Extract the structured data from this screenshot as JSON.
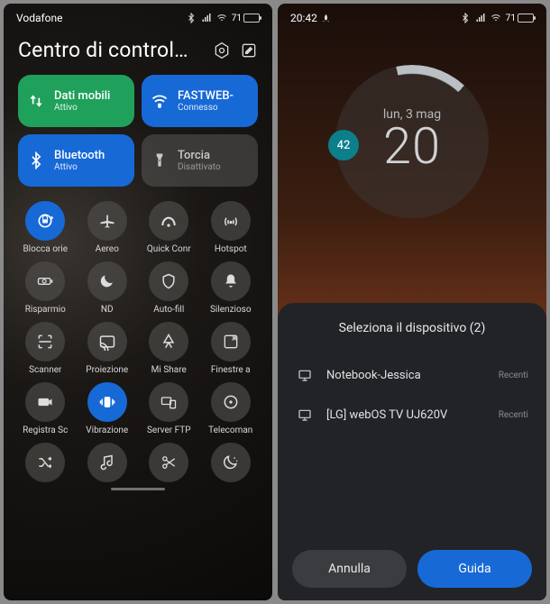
{
  "left": {
    "status": {
      "carrier": "Vodafone",
      "battery": "71"
    },
    "header": {
      "title": "Centro di control…",
      "settings_icon": "gear",
      "edit_icon": "edit"
    },
    "tiles": [
      {
        "name": "mobile-data",
        "label": "Dati mobili",
        "sub": "Attivo",
        "color": "green",
        "icon": "arrows-ud"
      },
      {
        "name": "wifi",
        "label": "FASTWEB-",
        "sub": "Connesso",
        "color": "blue",
        "icon": "wifi"
      },
      {
        "name": "bluetooth",
        "label": "Bluetooth",
        "sub": "Attivo",
        "color": "blue",
        "icon": "bluetooth"
      },
      {
        "name": "torch",
        "label": "Torcia",
        "sub": "Disattivato",
        "color": "grey",
        "icon": "torch"
      }
    ],
    "toggles": [
      {
        "name": "rotation-lock",
        "label": "Blocca orie",
        "icon": "lock-rot",
        "active": true
      },
      {
        "name": "airplane",
        "label": "Aereo",
        "icon": "airplane",
        "active": false
      },
      {
        "name": "quick-connect",
        "label": "Quick Conr",
        "icon": "vpn",
        "active": false
      },
      {
        "name": "hotspot",
        "label": "Hotspot",
        "icon": "hotspot",
        "active": false
      },
      {
        "name": "battery-saver",
        "label": "Risparmio",
        "icon": "battery",
        "active": false
      },
      {
        "name": "dnd",
        "label": "ND",
        "icon": "moon",
        "active": false
      },
      {
        "name": "autofill",
        "label": "Auto-fill",
        "icon": "shield",
        "active": false
      },
      {
        "name": "silent",
        "label": "Silenzioso",
        "icon": "bell",
        "active": false
      },
      {
        "name": "scanner",
        "label": "Scanner",
        "icon": "scan",
        "active": false
      },
      {
        "name": "cast",
        "label": "Proiezione",
        "icon": "cast",
        "active": false
      },
      {
        "name": "mi-share",
        "label": "Mi Share",
        "icon": "share",
        "active": false
      },
      {
        "name": "float-window",
        "label": "Finestre a",
        "icon": "float",
        "active": false
      },
      {
        "name": "screen-record",
        "label": "Registra Sc",
        "icon": "camera",
        "active": false
      },
      {
        "name": "vibration",
        "label": "Vibrazione",
        "icon": "vibrate",
        "active": true
      },
      {
        "name": "ftp",
        "label": "Server FTP",
        "icon": "devices",
        "active": false
      },
      {
        "name": "remote",
        "label": "Telecoman",
        "icon": "remote",
        "active": false
      },
      {
        "name": "shuffle",
        "label": "",
        "icon": "shuffle",
        "active": false
      },
      {
        "name": "music",
        "label": "",
        "icon": "music",
        "active": false
      },
      {
        "name": "screenshot",
        "label": "",
        "icon": "scissors",
        "active": false
      },
      {
        "name": "night",
        "label": "",
        "icon": "night",
        "active": false
      }
    ]
  },
  "right": {
    "status": {
      "time": "20:42",
      "battery": "71"
    },
    "clock": {
      "date_line": "lun, 3 mag",
      "hour": "20",
      "minute": "42"
    },
    "sheet": {
      "title": "Seleziona il dispositivo (2)",
      "devices": [
        {
          "name": "Notebook-Jessica",
          "tag": "Recenti",
          "icon": "monitor"
        },
        {
          "name": "[LG] webOS TV UJ620V",
          "tag": "Recenti",
          "icon": "monitor"
        }
      ],
      "cancel": "Annulla",
      "help": "Guida"
    }
  }
}
